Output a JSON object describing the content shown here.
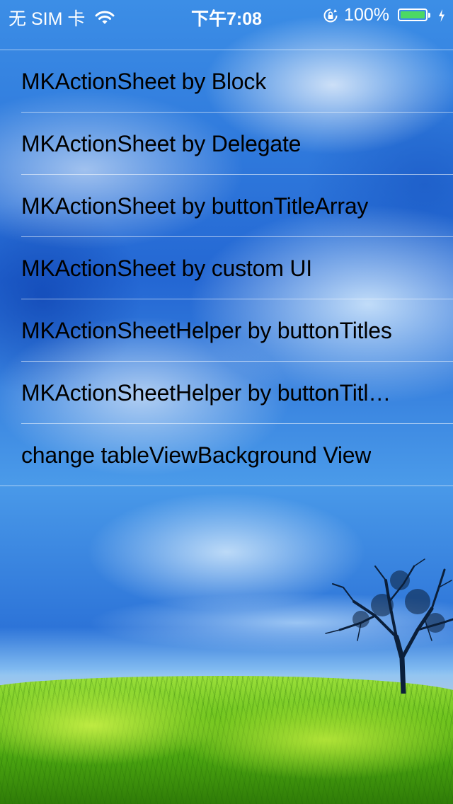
{
  "status_bar": {
    "carrier": "无 SIM 卡",
    "time": "下午7:08",
    "battery": "100%",
    "battery_level": 1.0,
    "wifi_icon": "wifi-icon",
    "rotation_lock_icon": "rotation-lock-icon",
    "charging_icon": "charging-bolt-icon",
    "battery_color": "#4cd964"
  },
  "table": {
    "rows": [
      {
        "label": "MKActionSheet by Block"
      },
      {
        "label": "MKActionSheet by Delegate"
      },
      {
        "label": "MKActionSheet by buttonTitleArray"
      },
      {
        "label": "MKActionSheet by custom UI"
      },
      {
        "label": "MKActionSheetHelper by buttonTitles"
      },
      {
        "label": "MKActionSheetHelper by buttonTitl…"
      },
      {
        "label": "change tableViewBackground View"
      }
    ],
    "text_color": "#000000",
    "separator_color": "#ffffff"
  }
}
